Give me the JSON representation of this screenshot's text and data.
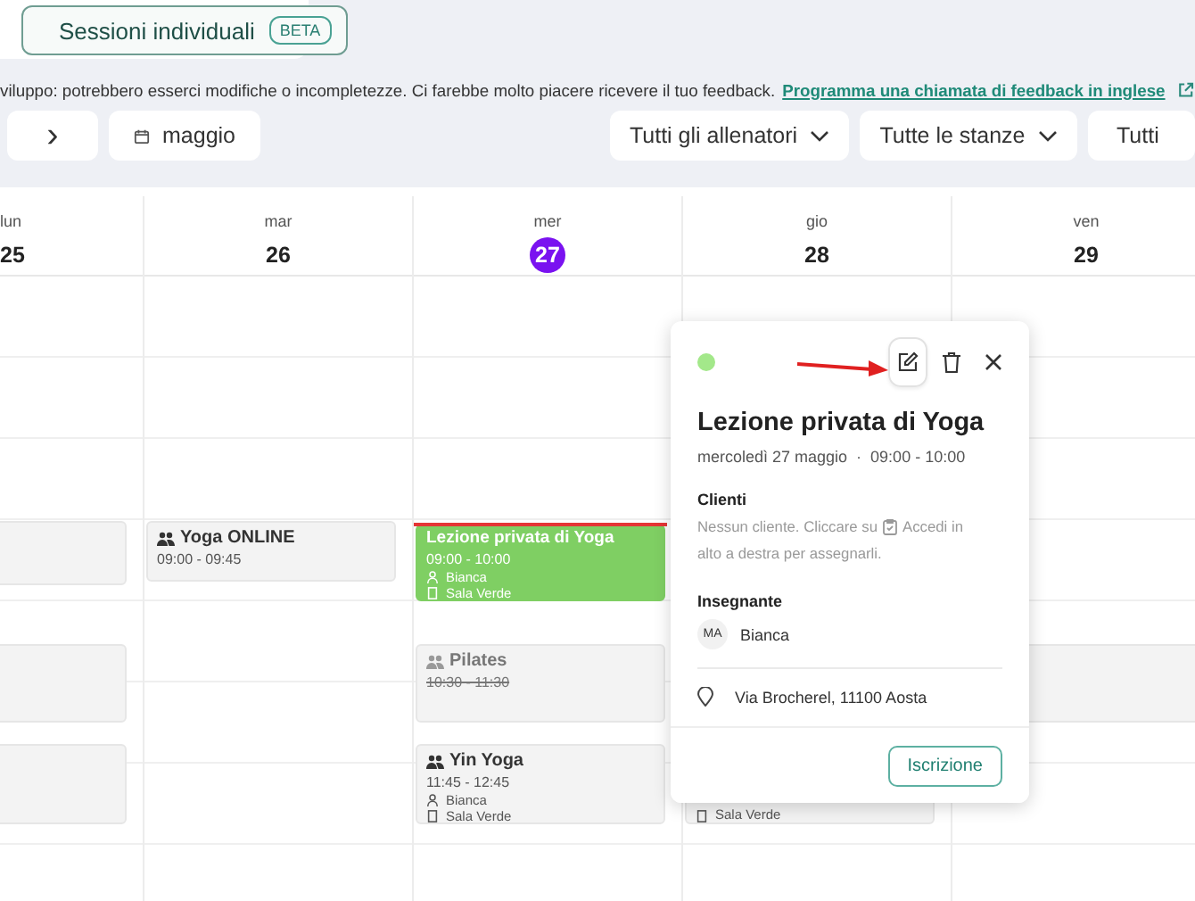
{
  "mode_tab": {
    "label": "Sessioni individuali",
    "badge": "BETA"
  },
  "notice": {
    "text": "viluppo: potrebbero esserci modifiche o incompletezze. Ci farebbe molto piacere ricevere il tuo feedback.",
    "link": "Programma una chiamata di feedback in inglese"
  },
  "toolbar": {
    "next": "›",
    "month": "maggio",
    "filters": [
      "Tutti gli allenatori",
      "Tutte le stanze",
      "Tutti"
    ]
  },
  "days": [
    {
      "weekday": "lun",
      "date": "25",
      "today": false,
      "events": [
        {
          "kind": "blank"
        },
        {
          "kind": "blank"
        },
        {
          "kind": "blank"
        }
      ]
    },
    {
      "weekday": "mar",
      "date": "26",
      "today": false,
      "events": [
        {
          "kind": "class",
          "title": "Yoga ONLINE",
          "time": "09:00 - 09:45",
          "cancelled": false
        }
      ]
    },
    {
      "weekday": "mer",
      "date": "27",
      "today": true,
      "events": [
        {
          "kind": "private",
          "title": "Lezione privata di Yoga",
          "time": "09:00 - 10:00",
          "trainer": "Bianca",
          "room": "Sala Verde"
        },
        {
          "kind": "class",
          "title": "Pilates",
          "time": "10:30 - 11:30",
          "cancelled": true
        },
        {
          "kind": "class",
          "title": "Yin Yoga",
          "time": "11:45 - 12:45",
          "trainer": "Bianca",
          "room": "Sala Verde",
          "cancelled": false
        }
      ]
    },
    {
      "weekday": "gio",
      "date": "28",
      "today": false,
      "events": [
        {
          "kind": "covered",
          "room": "Sala Verde"
        }
      ]
    },
    {
      "weekday": "ven",
      "date": "29",
      "today": false,
      "events": [
        {
          "kind": "blank"
        }
      ]
    }
  ],
  "popup": {
    "color": "#a3e88a",
    "title": "Lezione privata di Yoga",
    "date": "mercoledì 27 maggio",
    "separator": "·",
    "time": "09:00 - 10:00",
    "clients_heading": "Clienti",
    "clients_text_1": "Nessun cliente. Cliccare su",
    "clients_text_2": "Accedi in",
    "clients_text_3": "alto a destra per assegnarli.",
    "teacher_heading": "Insegnante",
    "teacher_initials": "MA",
    "teacher_name": "Bianca",
    "address": "Via Brocherel, 11100 Aosta",
    "action": "Iscrizione"
  }
}
